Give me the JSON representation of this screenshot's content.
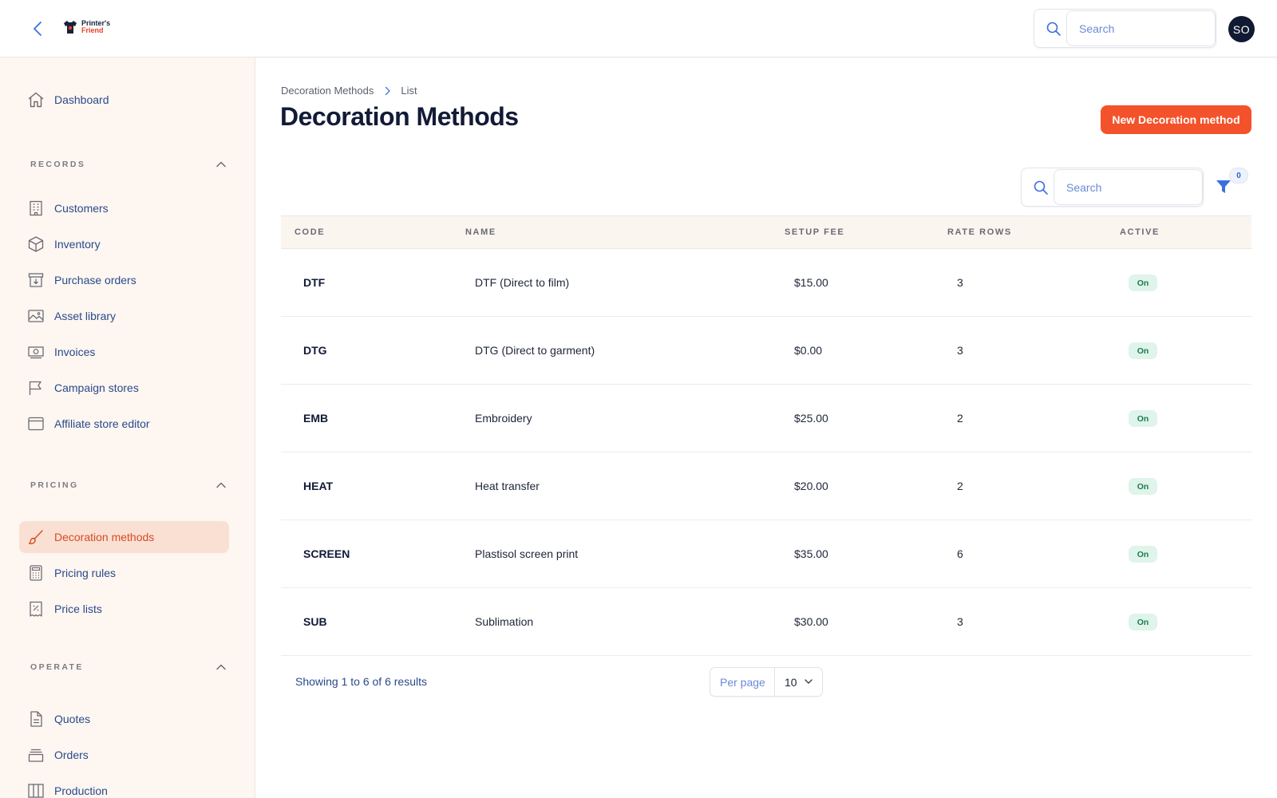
{
  "app": {
    "logo_line1": "Printer's",
    "logo_line2": "Friend",
    "search_placeholder": "Search",
    "avatar_initials": "SO"
  },
  "sidebar": {
    "dashboard": {
      "label": "Dashboard",
      "icon": "home-icon"
    },
    "sections": [
      {
        "title": "RECORDS",
        "items": [
          {
            "label": "Customers",
            "icon": "building-icon"
          },
          {
            "label": "Inventory",
            "icon": "box-icon"
          },
          {
            "label": "Purchase orders",
            "icon": "archive-download-icon"
          },
          {
            "label": "Asset library",
            "icon": "image-icon"
          },
          {
            "label": "Invoices",
            "icon": "cash-icon"
          },
          {
            "label": "Campaign stores",
            "icon": "flag-icon"
          },
          {
            "label": "Affiliate store editor",
            "icon": "browser-window-icon"
          }
        ]
      },
      {
        "title": "PRICING",
        "items": [
          {
            "label": "Decoration methods",
            "icon": "paintbrush-icon",
            "active": true
          },
          {
            "label": "Pricing rules",
            "icon": "calculator-icon"
          },
          {
            "label": "Price lists",
            "icon": "receipt-percent-icon"
          }
        ]
      },
      {
        "title": "OPERATE",
        "items": [
          {
            "label": "Quotes",
            "icon": "document-icon"
          },
          {
            "label": "Orders",
            "icon": "inbox-stack-icon"
          },
          {
            "label": "Production",
            "icon": "columns-icon"
          }
        ]
      }
    ]
  },
  "main": {
    "breadcrumb": [
      "Decoration Methods",
      "List"
    ],
    "title": "Decoration Methods",
    "new_button_label": "New Decoration method",
    "search_placeholder": "Search",
    "filter_count": "0",
    "table": {
      "columns": [
        "CODE",
        "NAME",
        "SETUP FEE",
        "RATE ROWS",
        "ACTIVE"
      ],
      "rows": [
        {
          "code": "DTF",
          "name": "DTF (Direct to film)",
          "setup_fee": "$15.00",
          "rate_rows": "3",
          "active": "On"
        },
        {
          "code": "DTG",
          "name": "DTG (Direct to garment)",
          "setup_fee": "$0.00",
          "rate_rows": "3",
          "active": "On"
        },
        {
          "code": "EMB",
          "name": "Embroidery",
          "setup_fee": "$25.00",
          "rate_rows": "2",
          "active": "On"
        },
        {
          "code": "HEAT",
          "name": "Heat transfer",
          "setup_fee": "$20.00",
          "rate_rows": "2",
          "active": "On"
        },
        {
          "code": "SCREEN",
          "name": "Plastisol screen print",
          "setup_fee": "$35.00",
          "rate_rows": "6",
          "active": "On"
        },
        {
          "code": "SUB",
          "name": "Sublimation",
          "setup_fee": "$30.00",
          "rate_rows": "3",
          "active": "On"
        }
      ]
    },
    "showing_text": "Showing 1 to 6 of 6 results",
    "per_page_label": "Per page",
    "per_page_value": "10"
  },
  "colors": {
    "accent": "#f4522a",
    "active_nav_bg": "#f9e0d3",
    "sidebar_bg": "#fdf6f1",
    "link": "#2a4a8a",
    "status_on_bg": "#dff4ea",
    "status_on_text": "#1f7a52"
  }
}
